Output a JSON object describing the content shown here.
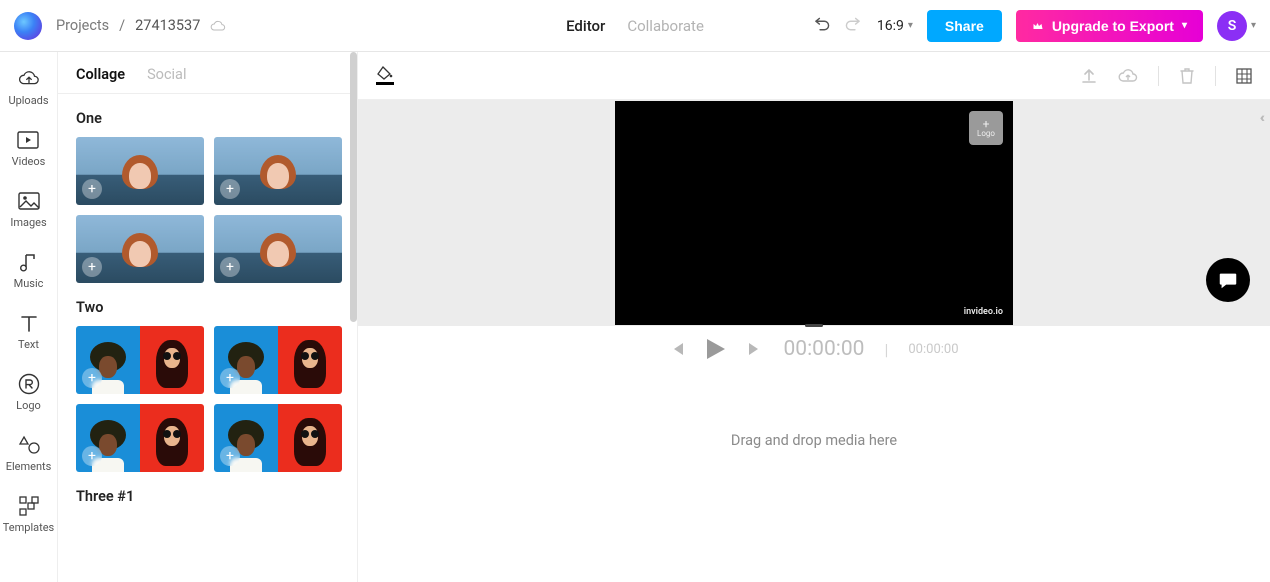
{
  "header": {
    "breadcrumb_root": "Projects",
    "breadcrumb_sep": "/",
    "project_id": "27413537",
    "tab_editor": "Editor",
    "tab_collab": "Collaborate",
    "aspect_ratio": "16:9",
    "share_label": "Share",
    "upgrade_label": "Upgrade to Export",
    "avatar_initial": "S"
  },
  "rail": {
    "uploads": "Uploads",
    "videos": "Videos",
    "images": "Images",
    "music": "Music",
    "text": "Text",
    "logo": "Logo",
    "elements": "Elements",
    "templates": "Templates"
  },
  "sidepanel": {
    "tab_collage": "Collage",
    "tab_social": "Social",
    "section_one": "One",
    "section_two": "Two",
    "section_three": "Three #1"
  },
  "canvas": {
    "logo_plus": "+",
    "logo_text": "Logo",
    "watermark": "invideo.io",
    "collapse_glyph": "‹‹"
  },
  "transport": {
    "current": "00:00:00",
    "sep": "|",
    "end": "00:00:00"
  },
  "timeline": {
    "placeholder": "Drag and drop media here"
  }
}
